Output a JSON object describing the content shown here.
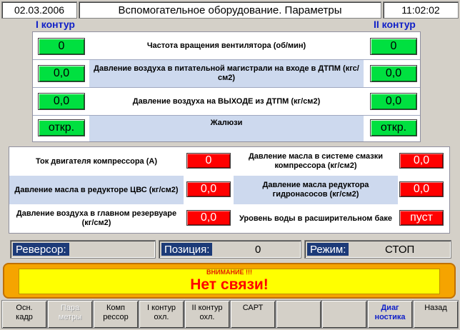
{
  "header": {
    "date": "02.03.2006",
    "title": "Вспомогательное оборудование. Параметры",
    "time": "11:02:02"
  },
  "circuits": {
    "left_label": "I контур",
    "right_label": "II контур"
  },
  "top_rows": [
    {
      "label": "Частота вращения вентилятора (об/мин)",
      "left": "0",
      "right": "0"
    },
    {
      "label": "Давление воздуха в питательной магистрали на входе в ДТПМ (кгс/см2)",
      "left": "0,0",
      "right": "0,0"
    },
    {
      "label": "Давление воздуха на ВЫХОДЕ из ДТПМ (кг/см2)",
      "left": "0,0",
      "right": "0,0"
    },
    {
      "label": "Жалюзи",
      "left": "откр.",
      "right": "откр."
    }
  ],
  "mid_rows": [
    {
      "label1": "Ток двигателя компрессора (А)",
      "value1": "0",
      "label2": "Давление масла в системе смазки компрессора (кг/см2)",
      "value2": "0,0"
    },
    {
      "label1": "Давление масла в редукторе ЦВС (кг/см2)",
      "value1": "0,0",
      "label2": "Давление масла редуктора гидронасосов (кг/см2)",
      "value2": "0,0"
    },
    {
      "label1": "Давление воздуха в главном резервуаре (кг/см2)",
      "value1": "0,0",
      "label2": "Уровень воды в расширительном баке",
      "value2": "пуст"
    }
  ],
  "status": {
    "reverser_label": "Реверсор:",
    "reverser_value": "",
    "position_label": "Позиция:",
    "position_value": "0",
    "mode_label": "Режим:",
    "mode_value": "СТОП"
  },
  "alert": {
    "heading": "ВНИМАНИЕ !!!",
    "message": "Нет связи!"
  },
  "nav": [
    {
      "line1": "Осн.",
      "line2": "кадр"
    },
    {
      "line1": "Пара",
      "line2": "метры"
    },
    {
      "line1": "Комп",
      "line2": "рессор"
    },
    {
      "line1": "I контур",
      "line2": "охл."
    },
    {
      "line1": "II контур",
      "line2": "охл."
    },
    {
      "line1": "САРТ",
      "line2": ""
    },
    {
      "line1": "",
      "line2": ""
    },
    {
      "line1": "",
      "line2": ""
    },
    {
      "line1": "Диаг",
      "line2": "ностика"
    },
    {
      "line1": "Назад",
      "line2": ""
    }
  ],
  "colors": {
    "ok_green": "#00e040",
    "value_red": "#ff0000",
    "alert_orange": "#f5a400",
    "alert_yellow": "#ffff00",
    "label_blue": "#1020c8",
    "status_label_bg": "#1c3a78"
  }
}
